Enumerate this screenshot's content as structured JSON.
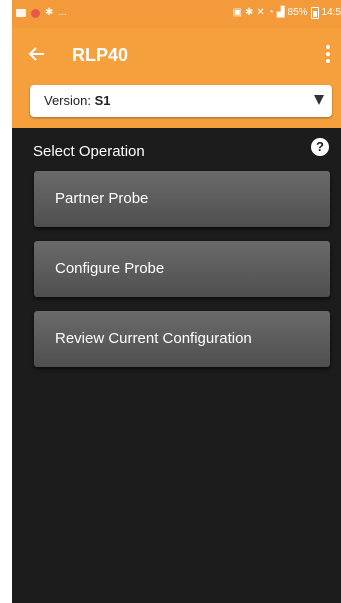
{
  "status_bar": {
    "notifications_text": "...",
    "battery_text": "85%",
    "time": "14:5"
  },
  "app_bar": {
    "title": "RLP40"
  },
  "version": {
    "label": "Version:",
    "value": "S1"
  },
  "operations": {
    "heading": "Select Operation",
    "items": [
      {
        "label": "Partner Probe"
      },
      {
        "label": "Configure Probe"
      },
      {
        "label": "Review Current Configuration"
      }
    ]
  },
  "colors": {
    "accent": "#f5a03d",
    "background": "#1c1c1c",
    "button": "#5a5a5a"
  },
  "icons": {
    "back": "arrow-left-icon",
    "menu": "more-vert-icon",
    "help": "help-circle-icon",
    "dropdown": "triangle-down-icon"
  }
}
